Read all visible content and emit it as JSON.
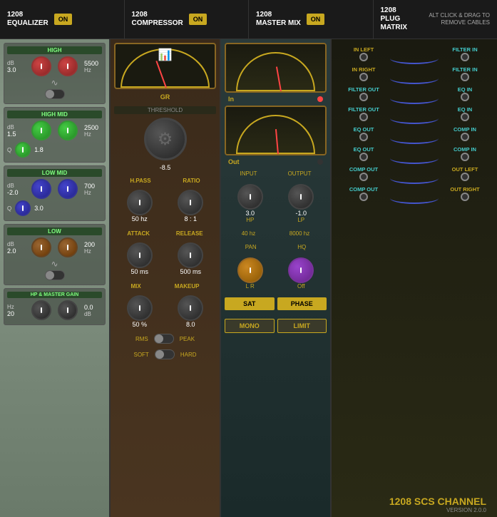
{
  "header": {
    "sections": [
      {
        "id": "eq",
        "title": "1208",
        "sub": "EQUALIZER",
        "btn": "ON"
      },
      {
        "id": "comp",
        "title": "1208",
        "sub": "COMPRESSOR",
        "btn": "ON"
      },
      {
        "id": "mix",
        "title": "1208",
        "sub": "MASTER MIX",
        "btn": "ON"
      },
      {
        "id": "matrix",
        "title": "1208",
        "sub": "PLUG MATRIX",
        "hint": "ALT CLICK & DRAG TO\nREMOVE CABLES"
      }
    ]
  },
  "eq": {
    "high": {
      "label": "HIGH",
      "db": "3.0",
      "hz": "5500",
      "hz_unit": "Hz"
    },
    "high_mid": {
      "label": "HIGH MID",
      "db": "1.5",
      "hz": "2500",
      "hz_unit": "Hz",
      "q": "1.8"
    },
    "low_mid": {
      "label": "LOW MID",
      "db": "-2.0",
      "hz": "700",
      "hz_unit": "Hz",
      "q": "3.0"
    },
    "low": {
      "label": "LOW",
      "db": "2.0",
      "hz": "200",
      "hz_unit": "Hz"
    },
    "hp_master": {
      "label": "HP & MASTER GAIN",
      "hz": "20",
      "hz_unit": "Hz",
      "db": "0.0",
      "db_unit": "dB"
    }
  },
  "comp": {
    "meter_label": "GR",
    "threshold_label": "THRESHOLD",
    "threshold_value": "-8.5",
    "hpass_label": "H.PASS",
    "hpass_value": "50 hz",
    "ratio_label": "RATIO",
    "ratio_value": "8 : 1",
    "attack_label": "ATTACK",
    "attack_value": "50 ms",
    "release_label": "RELEASE",
    "release_value": "500 ms",
    "mix_label": "MIX",
    "mix_value": "50 %",
    "makeup_label": "MAKEUP",
    "makeup_value": "8.0",
    "rms_label": "RMS",
    "peak_label": "PEAK",
    "soft_label": "SOFT",
    "hard_label": "HARD"
  },
  "mix": {
    "in_meter_label": "In",
    "out_meter_label": "Out",
    "input_label": "INPUT",
    "output_label": "OUTPUT",
    "input_value": "3.0",
    "output_value": "-1.0",
    "hp_label": "HP",
    "lp_label": "LP",
    "hp_value": "40 hz",
    "lp_value": "8000 hz",
    "pan_label": "PAN",
    "hq_label": "HQ",
    "pan_lr": "L     R",
    "hq_value": "Off",
    "sat_btn": "SAT",
    "phase_btn": "PHASE",
    "mono_btn": "MONO",
    "limit_btn": "LIMIT"
  },
  "matrix": {
    "hint": "ALT CLICK & DRAG TO REMOVE CABLES",
    "ports": [
      {
        "left": "IN LEFT",
        "right": "FILTER IN"
      },
      {
        "left": "IN RIGHT",
        "right": "FILTER IN"
      },
      {
        "left": "FILTER OUT",
        "right": "EQ IN"
      },
      {
        "left": "FILTER OUT",
        "right": "EQ IN"
      },
      {
        "left": "EQ OUT",
        "right": "COMP IN"
      },
      {
        "left": "EQ OUT",
        "right": "COMP IN"
      },
      {
        "left": "COMP OUT",
        "right": "OUT LEFT"
      },
      {
        "left": "COMP OUT",
        "right": "OUT RIGHT"
      }
    ],
    "footer": "1208 SCS CHANNEL",
    "version": "VERSION 2.0.0"
  }
}
